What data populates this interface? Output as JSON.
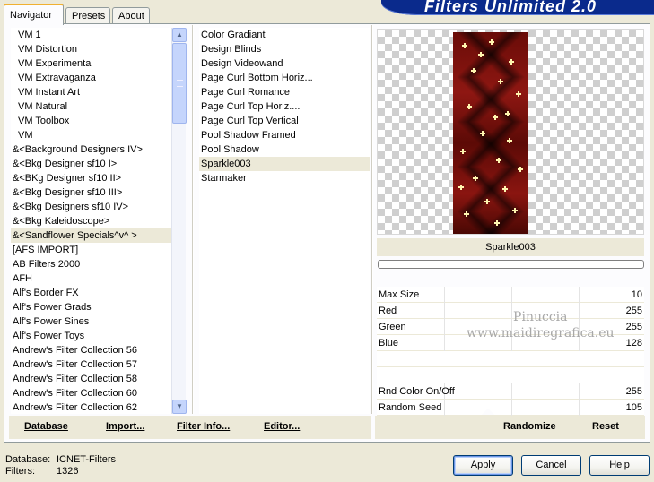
{
  "tabs": [
    {
      "label": "Navigator",
      "active": true
    },
    {
      "label": "Presets",
      "active": false
    },
    {
      "label": "About",
      "active": false
    }
  ],
  "banner": {
    "title": "Filters Unlimited 2.0"
  },
  "categories": [
    {
      "label": "VM 1",
      "indent": true
    },
    {
      "label": "VM Distortion",
      "indent": true
    },
    {
      "label": "VM Experimental",
      "indent": true
    },
    {
      "label": "VM Extravaganza",
      "indent": true
    },
    {
      "label": "VM Instant Art",
      "indent": true
    },
    {
      "label": "VM Natural",
      "indent": true
    },
    {
      "label": "VM Toolbox",
      "indent": true
    },
    {
      "label": "VM",
      "indent": true
    },
    {
      "label": "&<Background Designers IV>",
      "indent": false
    },
    {
      "label": "&<Bkg Designer sf10 I>",
      "indent": false
    },
    {
      "label": "&<BKg Designer sf10 II>",
      "indent": false
    },
    {
      "label": "&<Bkg Designer sf10 III>",
      "indent": false
    },
    {
      "label": "&<Bkg Designers sf10 IV>",
      "indent": false
    },
    {
      "label": "&<Bkg Kaleidoscope>",
      "indent": false
    },
    {
      "label": "&<Sandflower Specials^v^ >",
      "indent": false,
      "selected": true
    },
    {
      "label": "[AFS IMPORT]",
      "indent": false
    },
    {
      "label": "AB Filters 2000",
      "indent": false
    },
    {
      "label": "AFH",
      "indent": false
    },
    {
      "label": "Alf's Border FX",
      "indent": false
    },
    {
      "label": "Alf's Power Grads",
      "indent": false
    },
    {
      "label": "Alf's Power Sines",
      "indent": false
    },
    {
      "label": "Alf's Power Toys",
      "indent": false
    },
    {
      "label": "Andrew's Filter Collection 56",
      "indent": false
    },
    {
      "label": "Andrew's Filter Collection 57",
      "indent": false
    },
    {
      "label": "Andrew's Filter Collection 58",
      "indent": false
    },
    {
      "label": "Andrew's Filter Collection 60",
      "indent": false
    },
    {
      "label": "Andrew's Filter Collection 62",
      "indent": false
    }
  ],
  "filters": [
    {
      "label": "Color Gradiant"
    },
    {
      "label": "Design Blinds"
    },
    {
      "label": "Design Videowand"
    },
    {
      "label": "Page Curl Bottom Horiz..."
    },
    {
      "label": "Page Curl Romance"
    },
    {
      "label": "Page Curl Top Horiz...."
    },
    {
      "label": "Page Curl Top Vertical"
    },
    {
      "label": "Pool Shadow Framed"
    },
    {
      "label": "Pool Shadow"
    },
    {
      "label": "Sparkle003",
      "selected": true
    },
    {
      "label": "Starmaker"
    }
  ],
  "preview": {
    "filter_name": "Sparkle003"
  },
  "params": [
    {
      "label": "Max Size",
      "value": "10"
    },
    {
      "label": "Red",
      "value": "255"
    },
    {
      "label": "Green",
      "value": "255"
    },
    {
      "label": "Blue",
      "value": "128"
    },
    {
      "label": "",
      "value": ""
    },
    {
      "label": "",
      "value": ""
    },
    {
      "label": "Rnd Color On/Off",
      "value": "255"
    },
    {
      "label": "Random Seed",
      "value": "105"
    }
  ],
  "watermark": {
    "line1": "Pinuccia",
    "line2": "www.maidiregrafica.eu"
  },
  "toolbar": {
    "database": "Database",
    "import": "Import...",
    "filter_info": "Filter Info...",
    "editor": "Editor...",
    "randomize": "Randomize",
    "reset": "Reset"
  },
  "status": {
    "database_label": "Database:",
    "database_value": "ICNET-Filters",
    "filters_label": "Filters:",
    "filters_value": "1326"
  },
  "buttons": {
    "apply": "Apply",
    "cancel": "Cancel",
    "help": "Help"
  },
  "colors": {
    "accent": "#f0b030",
    "banner": "#0a2a8c",
    "button_border": "#003c74"
  }
}
